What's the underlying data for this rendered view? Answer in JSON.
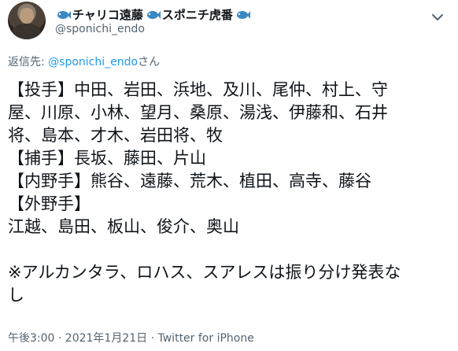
{
  "tweet": {
    "display_name_part1": "チャリコ遠藤",
    "display_name_part2": "スポニチ虎番",
    "handle": "@sponichi_endo",
    "reply_prefix": "返信先: ",
    "reply_mention": "@sponichi_endo",
    "reply_suffix": "さん",
    "lines": [
      "【投手】中田、岩田、浜地、及川、尾仲、村上、守",
      "屋、川原、小林、望月、桑原、湯浅、伊藤和、石井",
      "将、島本、才木、岩田将、牧",
      "【捕手】長坂、藤田、片山",
      "【内野手】熊谷、遠藤、荒木、植田、高寺、藤谷",
      "【外野手】",
      "江越、島田、板山、俊介、奥山",
      "",
      "※アルカンタラ、ロハス、スアレスは振り分け発表な",
      "し"
    ],
    "timestamp": "午後3:00 · 2021年1月21日",
    "separator": " · ",
    "source": "Twitter for iPhone"
  },
  "icons": {
    "fish": "fish-emoji-icon",
    "more": "chevron-down-icon"
  },
  "colors": {
    "link": "#1d9bf0",
    "secondary": "#536471",
    "text": "#0f1419"
  }
}
